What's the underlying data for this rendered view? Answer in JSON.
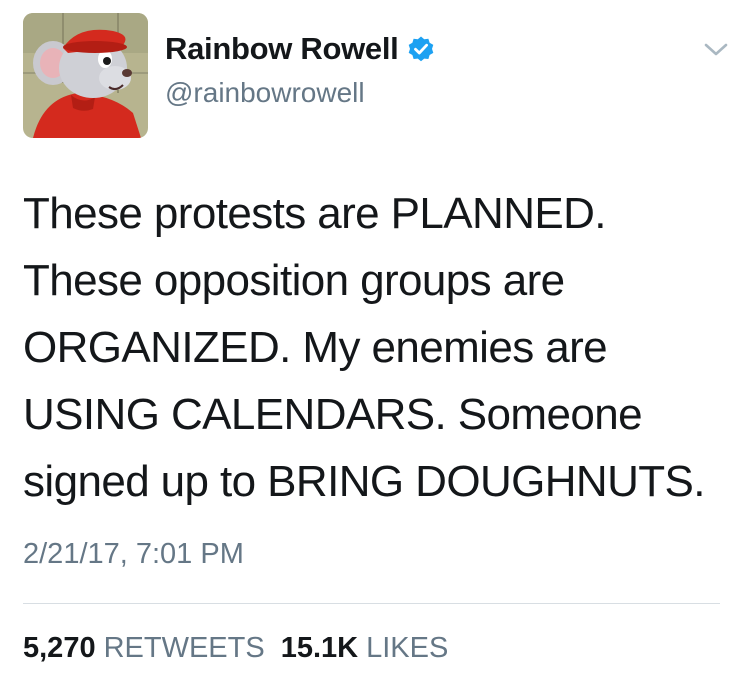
{
  "tweet": {
    "author": {
      "display_name": "Rainbow Rowell",
      "handle": "@rainbowrowell",
      "verified": true,
      "avatar_icon": "cartoon-mouse-avatar"
    },
    "text": "These protests are PLANNED.\nThese opposition groups are\nORGANIZED. My enemies are\nUSING CALENDARS. Someone\nsigned up to BRING DOUGHNUTS.",
    "timestamp": "2/21/17, 7:01 PM",
    "stats": {
      "retweets_count": "5,270",
      "retweets_label": "RETWEETS",
      "likes_count": "15.1K",
      "likes_label": "LIKES"
    }
  },
  "colors": {
    "verified_badge": "#1da1f2",
    "secondary_text": "#657786",
    "primary_text": "#14171a",
    "divider": "#d8dee3",
    "chevron": "#aab8c2"
  },
  "icons": {
    "verified": "verified-badge-icon",
    "menu": "chevron-down-icon"
  }
}
